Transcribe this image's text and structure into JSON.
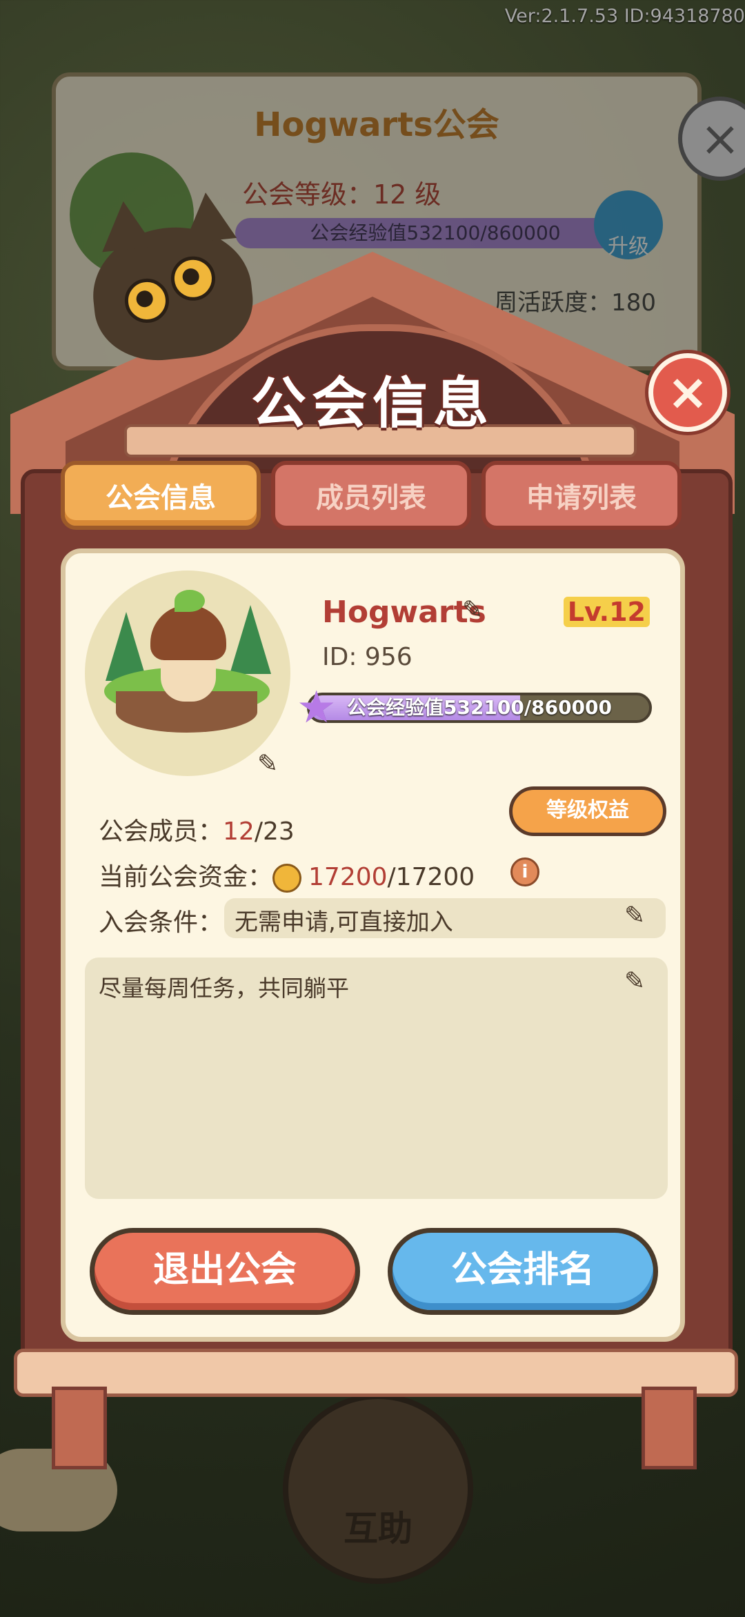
{
  "version_text": "Ver:2.1.7.53 ID:94318780",
  "background": {
    "guild_title": "Hogwarts公会",
    "level_text": "公会等级：12 级",
    "exp_text": "公会经验值532100/860000",
    "upgrade_label": "升级",
    "activity_text": "周活跃度：180",
    "help_label": "互助"
  },
  "dialog": {
    "title": "公会信息",
    "tabs": [
      {
        "label": "公会信息",
        "active": true
      },
      {
        "label": "成员列表",
        "active": false
      },
      {
        "label": "申请列表",
        "active": false
      }
    ]
  },
  "guild": {
    "name": "Hogwarts",
    "id_text": "ID: 956",
    "level_badge": "Lv.12",
    "exp_text": "公会经验值532100/860000",
    "exp_progress": 0.619,
    "perks_button": "等级权益",
    "members_label": "公会成员：",
    "members_current": "12",
    "members_max": "/23",
    "funds_label": "当前公会资金：",
    "funds_current": "17200",
    "funds_max": "/17200",
    "info_icon_text": "i",
    "join_label": "入会条件：",
    "join_value": "无需申请,可直接加入",
    "notice": "尽量每周任务，共同躺平"
  },
  "buttons": {
    "leave": "退出公会",
    "ranking": "公会排名"
  },
  "colors": {
    "accent_red": "#b23e35",
    "tab_active": "#f2ad55",
    "tab_inactive": "#d47567",
    "leave_button": "#e9735a",
    "rank_button": "#66b8ec"
  }
}
